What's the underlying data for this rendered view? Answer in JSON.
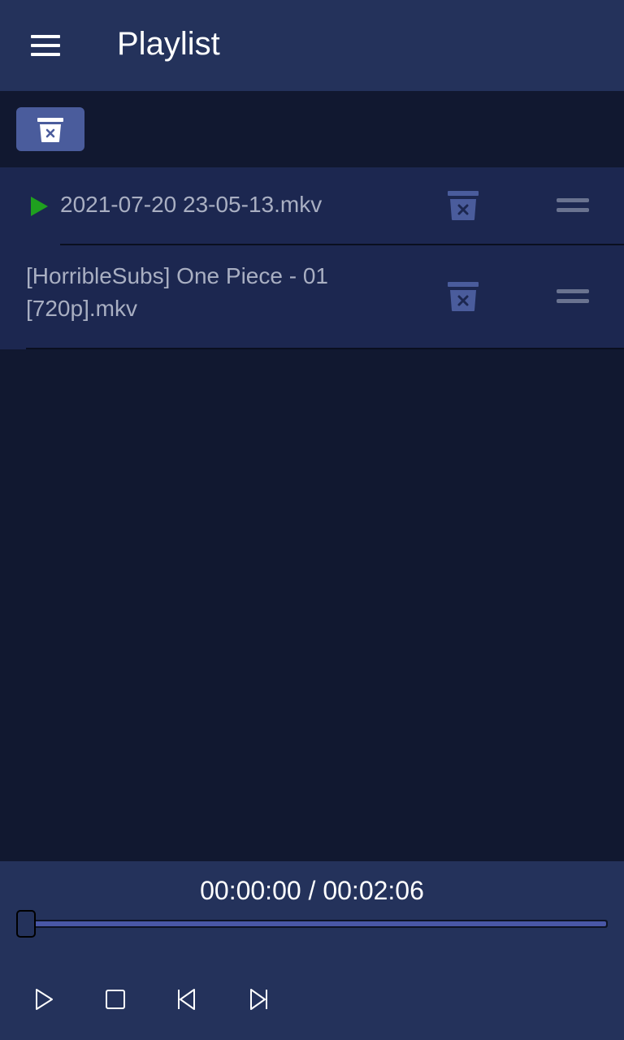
{
  "header": {
    "title": "Playlist",
    "menu_icon": "hamburger-menu-icon"
  },
  "toolbar": {
    "clear_icon": "trash-icon"
  },
  "playlist": {
    "items": [
      {
        "name": "2021-07-20 23-05-13.mkv",
        "playing": true
      },
      {
        "name": "[HorribleSubs] One Piece - 01 [720p].mkv",
        "playing": false
      }
    ],
    "item_icons": {
      "playing": "play-icon",
      "delete": "trash-icon",
      "reorder": "drag-handle-icon"
    }
  },
  "player": {
    "time": "00:00:00 / 00:02:06",
    "progress_fraction": 0,
    "controls": [
      "play-icon",
      "stop-icon",
      "skip-previous-icon",
      "skip-next-icon"
    ]
  },
  "colors": {
    "header_bg": "#24325b",
    "page_bg": "#111830",
    "list_bg": "#1c2750",
    "accent": "#4a5c9c",
    "playing_indicator": "#1fa01f"
  }
}
